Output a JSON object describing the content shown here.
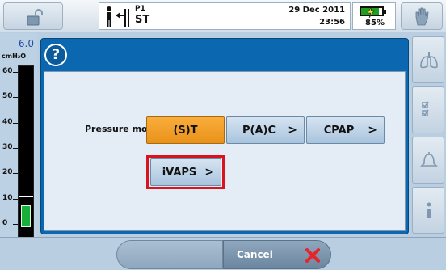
{
  "status_bar": {
    "profile_id": "P1",
    "profile_mode": "ST",
    "date": "29 Dec 2011",
    "time": "23:56",
    "battery_percent_text": "85%",
    "battery_fill_fraction": 0.85
  },
  "gauge": {
    "value": "6.0",
    "unit": "cmH₂O",
    "ticks": [
      "60",
      "50",
      "40",
      "30",
      "20",
      "10",
      "0"
    ],
    "level": 6.0,
    "max": 60
  },
  "dialog": {
    "help_glyph": "?",
    "caption": "Pressure modes",
    "modes": [
      {
        "label": "(S)T",
        "selected": true,
        "has_chevron": false
      },
      {
        "label": "P(A)C",
        "selected": false,
        "has_chevron": true
      },
      {
        "label": "CPAP",
        "selected": false,
        "has_chevron": true
      },
      {
        "label": "iVAPS",
        "selected": false,
        "has_chevron": true,
        "highlighted": true
      }
    ],
    "chevron": ">"
  },
  "bottom_bar": {
    "cancel_label": "Cancel"
  },
  "sidebar": {
    "buttons": [
      "lungs-icon",
      "checklist-icon",
      "alarm-bell-icon",
      "info-icon"
    ]
  },
  "colors": {
    "selected_mode": "#f5a12b",
    "highlight_outline": "#d8141e",
    "dialog_header": "#0b67b0",
    "gauge_fill": "#18b038",
    "battery": "#1ea01e"
  }
}
